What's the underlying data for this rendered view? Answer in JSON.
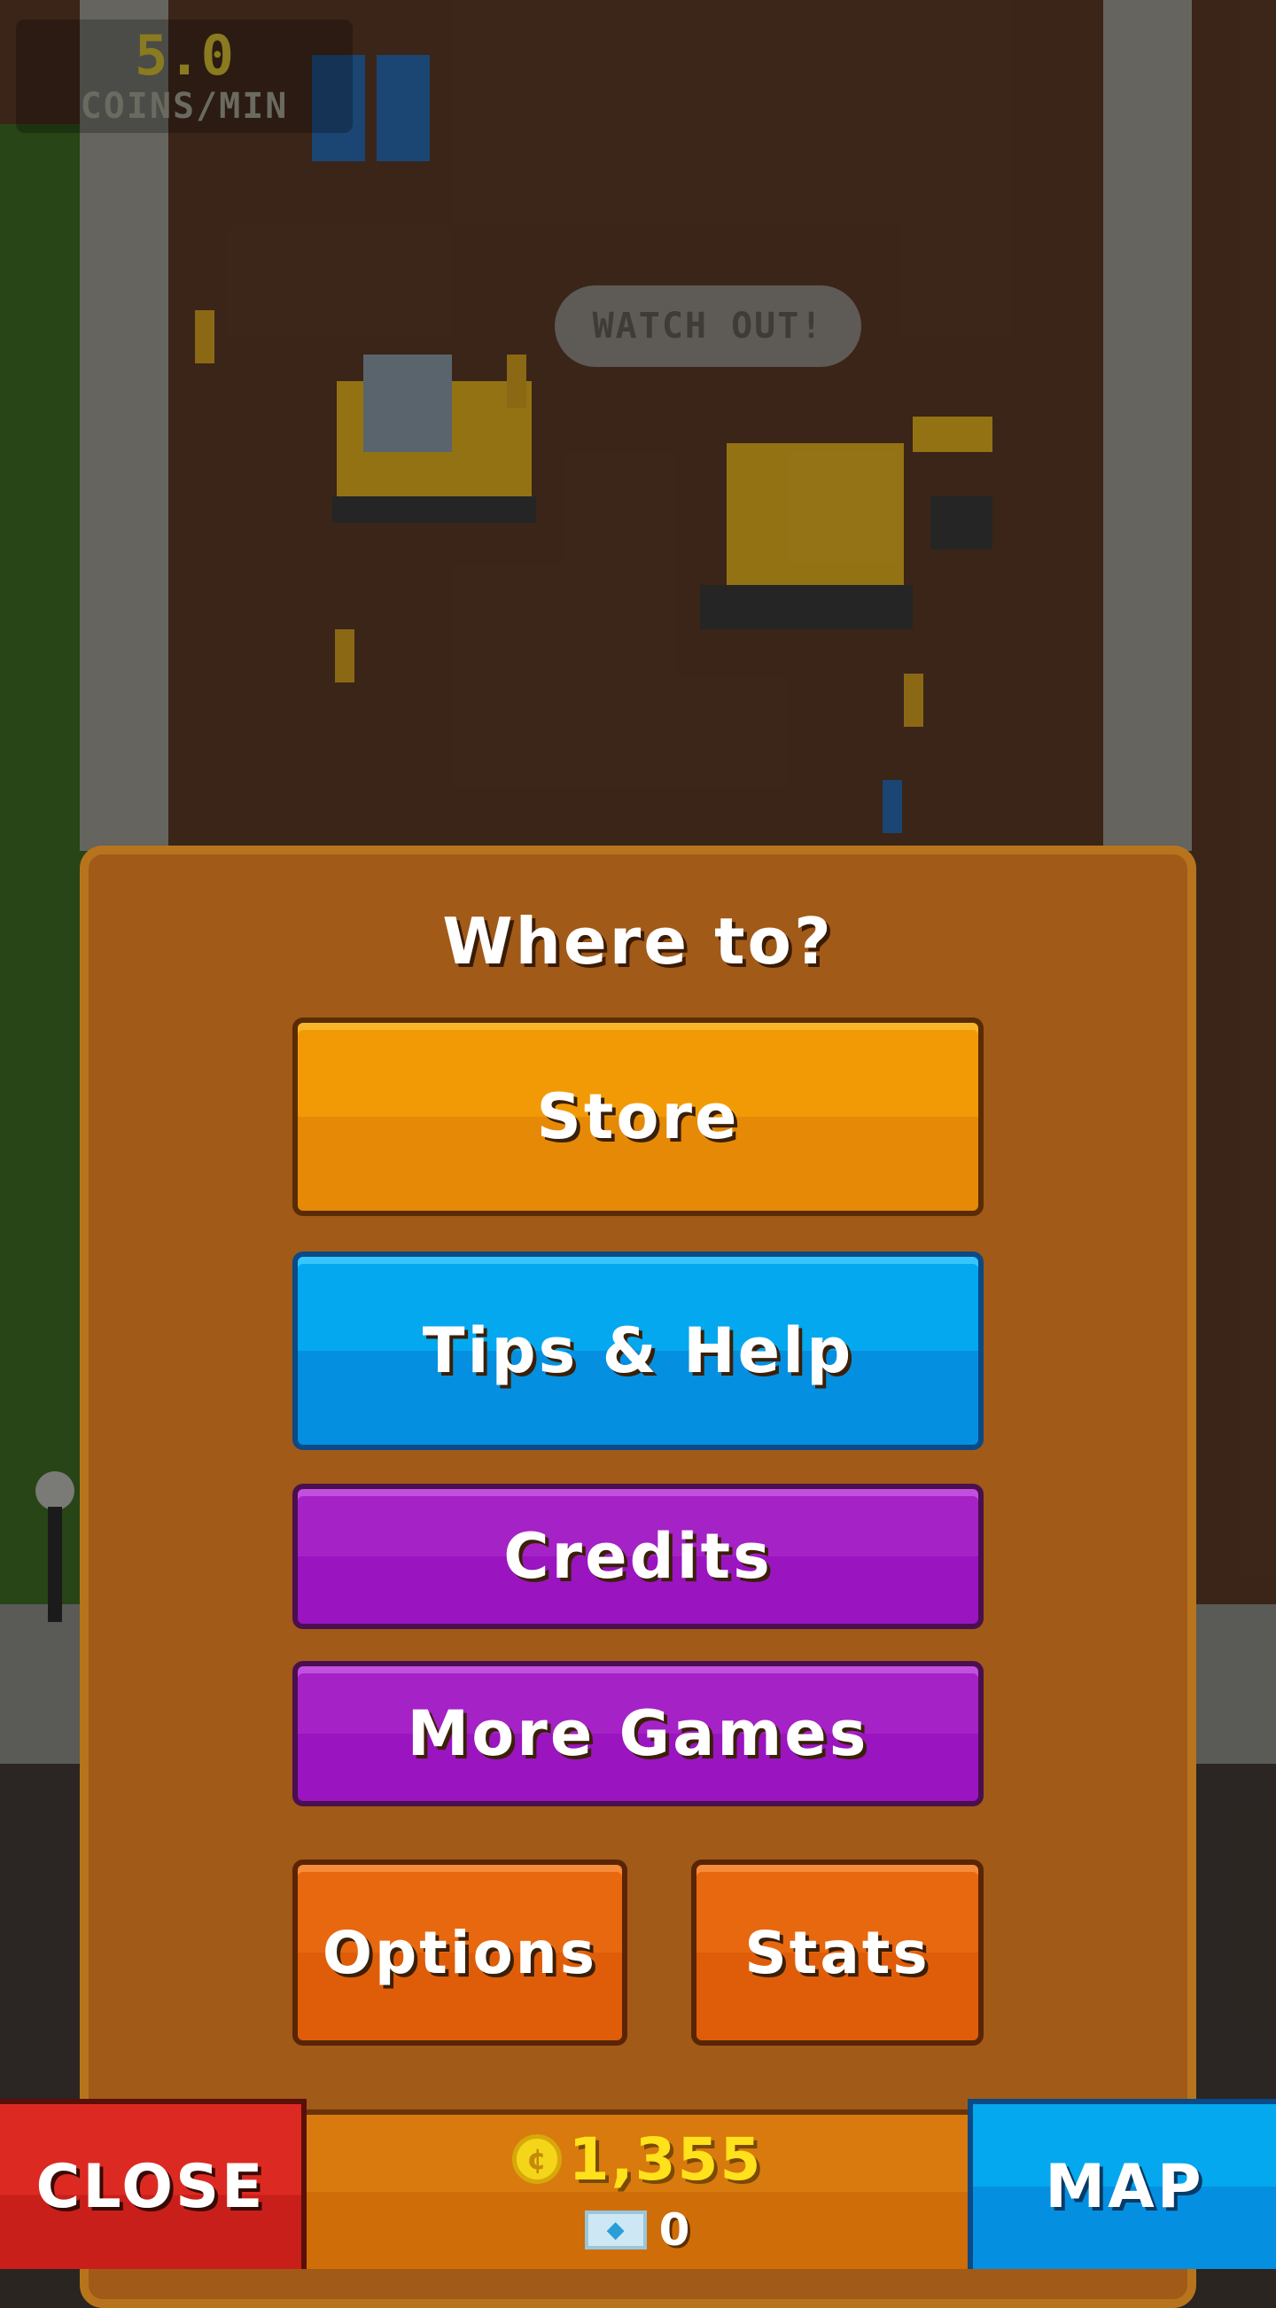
{
  "hud": {
    "rate_value": "5.0",
    "rate_unit": "COINS/MIN"
  },
  "scene": {
    "speech_bubble": "WATCH OUT!"
  },
  "menu": {
    "title": "Where to?",
    "buttons": {
      "store": "Store",
      "tips": "Tips & Help",
      "credits": "Credits",
      "more_games": "More Games",
      "options": "Options",
      "stats": "Stats"
    }
  },
  "bottom_bar": {
    "close_label": "CLOSE",
    "map_label": "MAP",
    "coins": "1,355",
    "gems": "0"
  },
  "colors": {
    "panel": "#a15a17",
    "store": "#f29a05",
    "tips": "#04a8ee",
    "purple": "#a522c6",
    "orange": "#e86810",
    "close": "#dc2a22",
    "coin": "#ffe11c"
  },
  "icons": {
    "coin": "coin-icon",
    "gem": "gem-icon"
  }
}
